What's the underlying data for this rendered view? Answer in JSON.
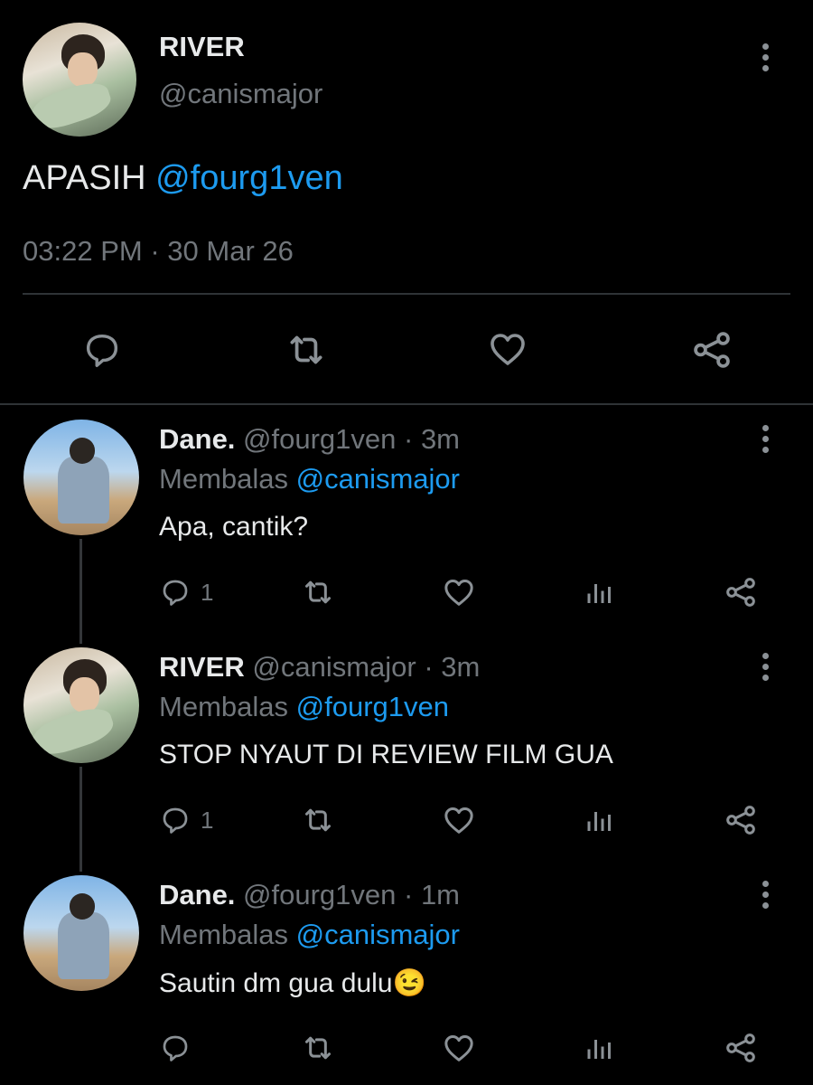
{
  "main_tweet": {
    "display_name": "RIVER",
    "handle": "@canismajor",
    "text": "APASIH",
    "mention": "@fourg1ven",
    "time": "03:22 PM",
    "separator": "·",
    "date": "30 Mar 26",
    "actions": [
      "reply-icon",
      "retweet-icon",
      "like-icon",
      "share-icon"
    ]
  },
  "replies": [
    {
      "display_name": "Dane.",
      "meta": "@fourg1ven · 3m",
      "replying_label": "Membalas",
      "replying_to": "@canismajor",
      "text": "Apa, cantik?",
      "reply_count": "1"
    },
    {
      "display_name": "RIVER",
      "meta": "@canismajor · 3m",
      "replying_label": "Membalas",
      "replying_to": "@fourg1ven",
      "text": "STOP NYAUT DI REVIEW FILM GUA",
      "reply_count": "1"
    },
    {
      "display_name": "Dane.",
      "meta": "@fourg1ven · 1m",
      "replying_label": "Membalas",
      "replying_to": "@canismajor",
      "text": "Sautin dm gua dulu",
      "emoji": "😉",
      "reply_count": ""
    }
  ],
  "colors": {
    "background": "#000000",
    "text": "#e7e9ea",
    "muted": "#71767b",
    "link": "#1d9bf0",
    "divider": "#2f3336"
  }
}
